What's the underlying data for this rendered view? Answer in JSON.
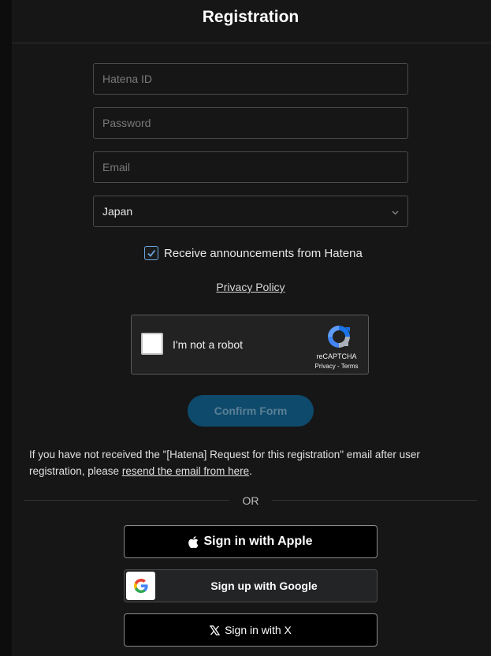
{
  "header": {
    "title": "Registration"
  },
  "form": {
    "hatena_id_placeholder": "Hatena ID",
    "password_placeholder": "Password",
    "email_placeholder": "Email",
    "country_value": "Japan",
    "announcements_label": "Receive announcements from Hatena",
    "announcements_checked": true,
    "privacy_link": "Privacy Policy"
  },
  "captcha": {
    "label": "I'm not a robot",
    "brand": "reCAPTCHA",
    "privacy": "Privacy",
    "separator": " - ",
    "terms": "Terms"
  },
  "confirm_button": "Confirm Form",
  "notice": {
    "text_before": "If you have not received the \"[Hatena] Request for this registration\" email after user registration, please ",
    "link": "resend the email from here",
    "text_after": "."
  },
  "divider": {
    "label": "OR"
  },
  "social": {
    "apple_label": "Sign in with Apple",
    "google_label": "Sign up with Google",
    "x_label": "Sign in with X"
  },
  "colors": {
    "background": "#161616",
    "confirm_button": "#0e4a6c",
    "checkbox_accent": "#6aa6e0"
  },
  "icons": {
    "chevron": "chevron-down-icon",
    "check": "check-icon",
    "recaptcha": "recaptcha-icon",
    "apple": "apple-icon",
    "google": "google-icon",
    "x": "x-icon"
  }
}
